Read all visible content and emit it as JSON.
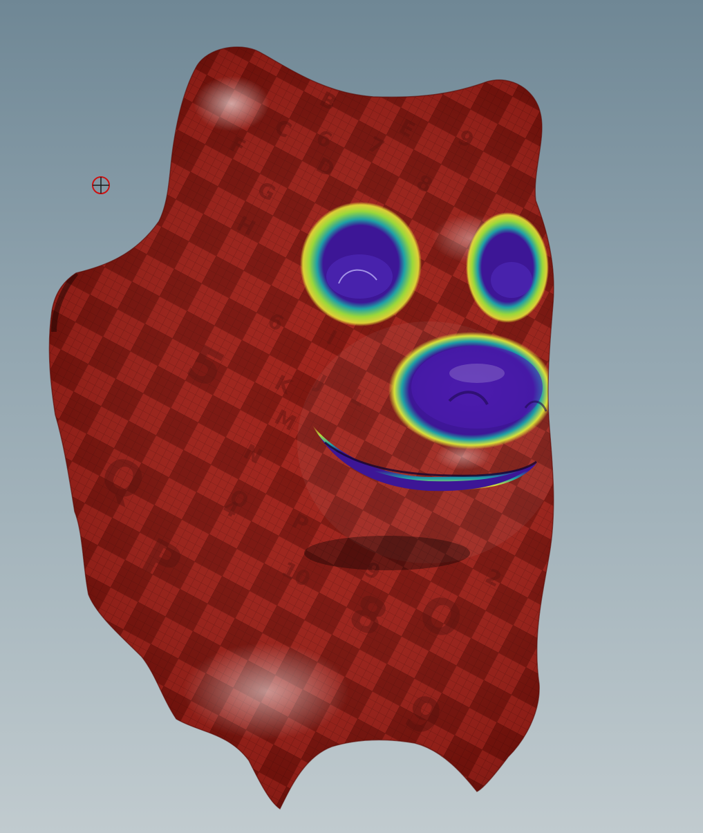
{
  "viewport": {
    "background_top": "#6f8795",
    "background_bottom": "#c1cbcf"
  },
  "model": {
    "base_color": "#8e1810",
    "checker_dark": "#7a130d",
    "checker_light": "#a2231a",
    "wire_color": "#4a0a08",
    "attribute_low_color": "#3d1696",
    "attribute_mid_color": "#1ea0a6",
    "attribute_high_color": "#e6e23a",
    "uv_grid_glyphs": [
      "B",
      "C",
      "6",
      "D",
      "7",
      "E",
      "8",
      "9",
      "F",
      "G",
      "H",
      "5",
      "6",
      "I",
      "J",
      "K",
      "L",
      "M",
      "N",
      "O",
      "P",
      "9",
      "10",
      "2",
      "4",
      "5",
      "Q",
      "P",
      "9",
      "8",
      "O"
    ]
  },
  "handle": {
    "icon": "pivot-crosshair-icon",
    "color": "#cc1111"
  }
}
